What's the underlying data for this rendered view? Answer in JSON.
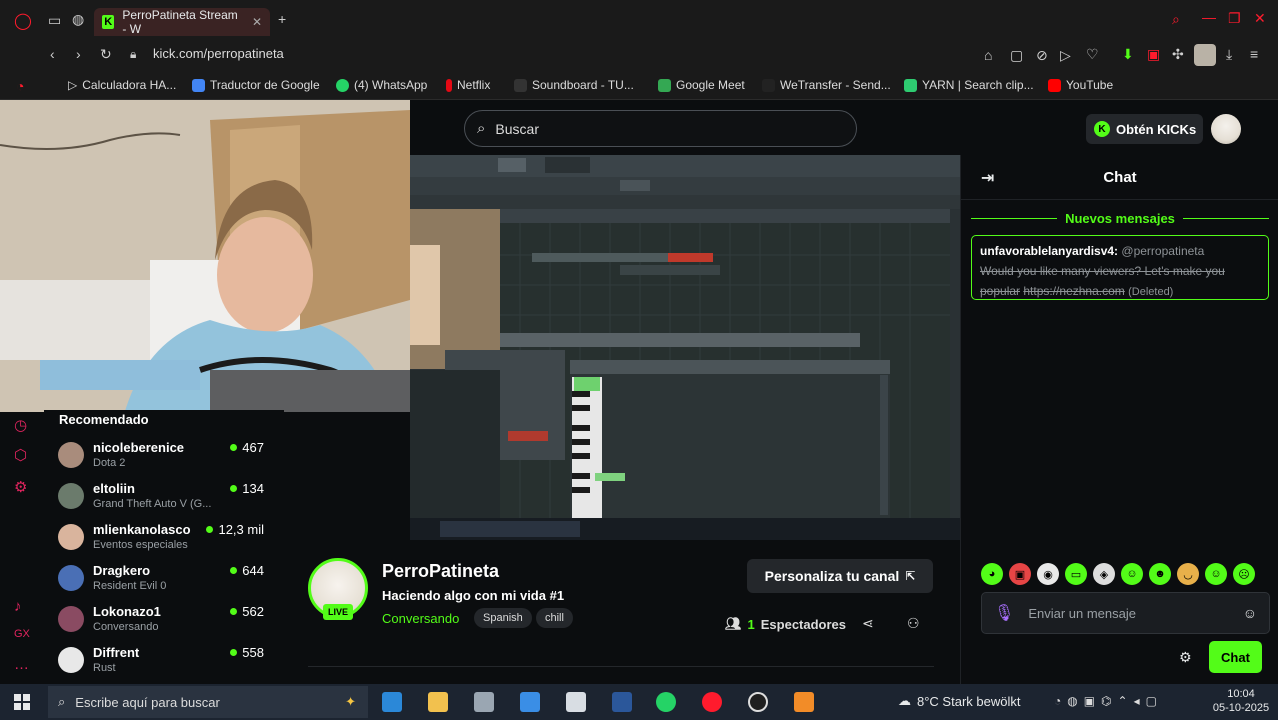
{
  "browser": {
    "tab_title": "PerroPatineta Stream - W",
    "url": "kick.com/perropatineta",
    "bookmarks": [
      {
        "label": "Calculadora HA...",
        "color": "#444444"
      },
      {
        "label": "Traductor de Google",
        "color": "#4285f4"
      },
      {
        "label": "(4) WhatsApp",
        "color": "#25d366"
      },
      {
        "label": "Netflix",
        "color": "#e50914"
      },
      {
        "label": "Soundboard - TU...",
        "color": "#333333"
      },
      {
        "label": "Google Meet",
        "color": "#34a853"
      },
      {
        "label": "WeTransfer - Send...",
        "color": "#222222"
      },
      {
        "label": "YARN | Search clip...",
        "color": "#2ecc71"
      },
      {
        "label": "YouTube",
        "color": "#ff0000"
      }
    ]
  },
  "header": {
    "search_placeholder": "Buscar",
    "kicks_label": "Obtén KICKs"
  },
  "recommended": {
    "title": "Recomendado",
    "items": [
      {
        "name": "nicoleberenice",
        "category": "Dota 2",
        "viewers": "467"
      },
      {
        "name": "eltoliin",
        "category": "Grand Theft Auto V (G...",
        "viewers": "134"
      },
      {
        "name": "mlienkanolasco",
        "category": "Eventos especiales",
        "viewers": "12,3 mil"
      },
      {
        "name": "Dragkero",
        "category": "Resident Evil 0",
        "viewers": "644"
      },
      {
        "name": "Lokonazo1",
        "category": "Conversando",
        "viewers": "562"
      },
      {
        "name": "Diffrent",
        "category": "Rust",
        "viewers": "558"
      }
    ]
  },
  "stream": {
    "channel_name": "PerroPatineta",
    "live_label": "LIVE",
    "title": "Haciendo algo con mi vida #1",
    "category": "Conversando",
    "tags": [
      "Spanish",
      "chill"
    ],
    "customize_label": "Personaliza tu canal",
    "viewers_count": "1",
    "viewers_label": "Espectadores"
  },
  "chat": {
    "title": "Chat",
    "new_messages_label": "Nuevos mensajes",
    "message": {
      "user": "unfavorablelanyardisv4:",
      "mention": "@perropatineta",
      "text": "Would you like many viewers? Let's make you popular",
      "link": "https://nezhna.com",
      "deleted": "(Deleted)"
    },
    "input_placeholder": "Enviar un mensaje",
    "send_label": "Chat"
  },
  "taskbar": {
    "search_placeholder": "Escribe aquí para buscar",
    "weather": "8°C  Stark bewölkt",
    "time": "10:04",
    "date": "05-10-2025"
  }
}
